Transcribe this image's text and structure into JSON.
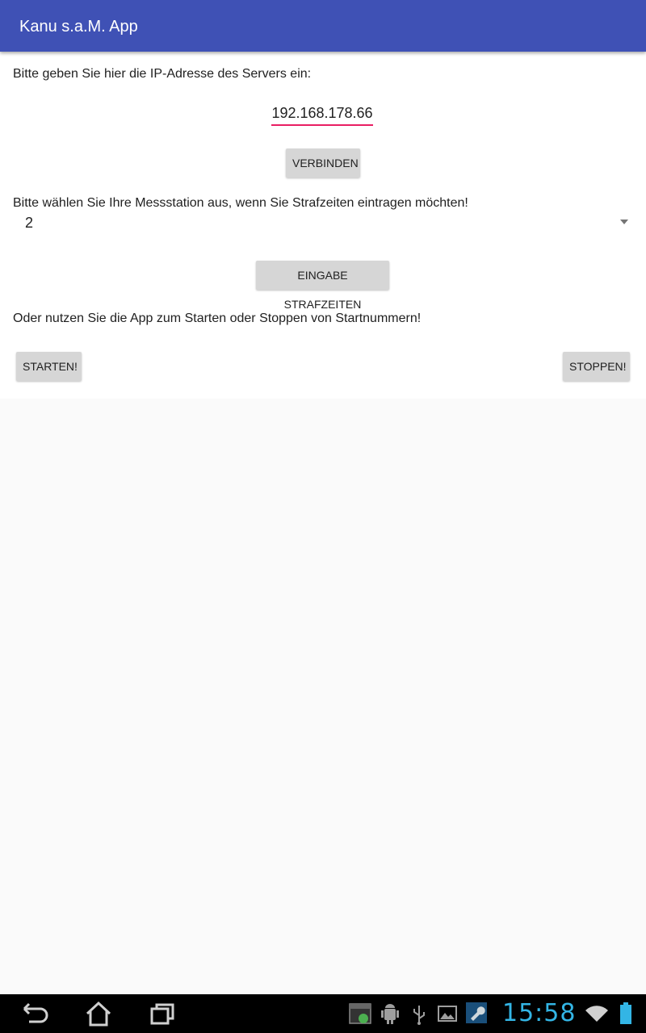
{
  "app": {
    "title": "Kanu s.a.M. App"
  },
  "server": {
    "prompt": "Bitte geben Sie hier die IP-Adresse des Servers ein:",
    "ip_value": "192.168.178.66",
    "connect_label": "VERBINDEN"
  },
  "station": {
    "prompt": "Bitte wählen Sie Ihre Messstation aus, wenn Sie Strafzeiten eintragen möchten!",
    "selected": "2",
    "penalty_label": "EINGABE STRAFZEITEN"
  },
  "start_stop": {
    "prompt": "Oder nutzen Sie die App zum Starten oder Stoppen von Startnummern!",
    "start_label": "STARTEN!",
    "stop_label": "STOPPEN!"
  },
  "system_bar": {
    "time": "15:58",
    "icons": [
      "back-icon",
      "home-icon",
      "recent-apps-icon",
      "screenshot-icon",
      "android-debug-icon",
      "usb-icon",
      "gallery-icon",
      "wrench-icon",
      "wifi-icon",
      "battery-icon"
    ],
    "accent_color": "#33b5e5"
  },
  "colors": {
    "app_bar": "#3f51b5",
    "input_underline": "#e91e63",
    "button_bg": "#d6d6d6"
  }
}
